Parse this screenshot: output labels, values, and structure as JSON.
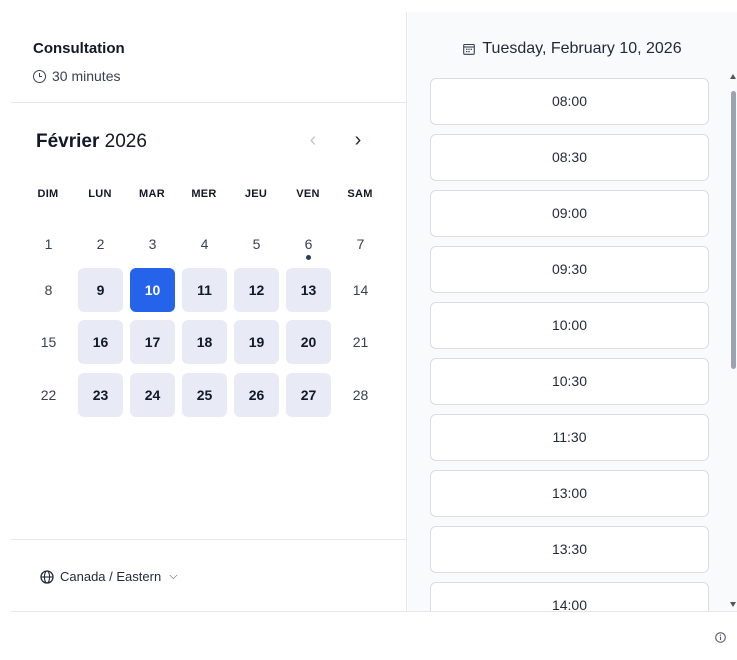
{
  "event": {
    "title": "Consultation",
    "duration": "30 minutes"
  },
  "calendar": {
    "month": "Février",
    "year": "2026",
    "weekdays": [
      "DIM",
      "LUN",
      "MAR",
      "MER",
      "JEU",
      "VEN",
      "SAM"
    ],
    "weeks": [
      [
        {
          "d": "1",
          "s": "plain"
        },
        {
          "d": "2",
          "s": "plain"
        },
        {
          "d": "3",
          "s": "plain"
        },
        {
          "d": "4",
          "s": "plain"
        },
        {
          "d": "5",
          "s": "plain"
        },
        {
          "d": "6",
          "s": "today"
        },
        {
          "d": "7",
          "s": "plain"
        }
      ],
      [
        {
          "d": "8",
          "s": "plain"
        },
        {
          "d": "9",
          "s": "available"
        },
        {
          "d": "10",
          "s": "selected"
        },
        {
          "d": "11",
          "s": "available"
        },
        {
          "d": "12",
          "s": "available"
        },
        {
          "d": "13",
          "s": "available"
        },
        {
          "d": "14",
          "s": "plain"
        }
      ],
      [
        {
          "d": "15",
          "s": "plain"
        },
        {
          "d": "16",
          "s": "available"
        },
        {
          "d": "17",
          "s": "available"
        },
        {
          "d": "18",
          "s": "available"
        },
        {
          "d": "19",
          "s": "available"
        },
        {
          "d": "20",
          "s": "available"
        },
        {
          "d": "21",
          "s": "plain"
        }
      ],
      [
        {
          "d": "22",
          "s": "plain"
        },
        {
          "d": "23",
          "s": "available"
        },
        {
          "d": "24",
          "s": "available"
        },
        {
          "d": "25",
          "s": "available"
        },
        {
          "d": "26",
          "s": "available"
        },
        {
          "d": "27",
          "s": "available"
        },
        {
          "d": "28",
          "s": "plain"
        }
      ]
    ]
  },
  "timezone": {
    "label": "Canada / Eastern"
  },
  "schedule": {
    "date": "Tuesday, February 10, 2026",
    "slots": [
      "08:00",
      "08:30",
      "09:00",
      "09:30",
      "10:00",
      "10:30",
      "11:30",
      "13:00",
      "13:30",
      "14:00"
    ]
  },
  "icons": {
    "duration": "clock-icon",
    "timezone": "globe-icon",
    "date": "calendar-icon",
    "info": "info-icon",
    "prev": "chevron-left-icon",
    "next": "chevron-right-icon",
    "dropdown": "chevron-down-icon"
  },
  "colors": {
    "accent": "#2563eb",
    "available_bg": "#e8ebf5",
    "panel_bg": "#f9fafb",
    "today_dot": "#2b3a67"
  }
}
